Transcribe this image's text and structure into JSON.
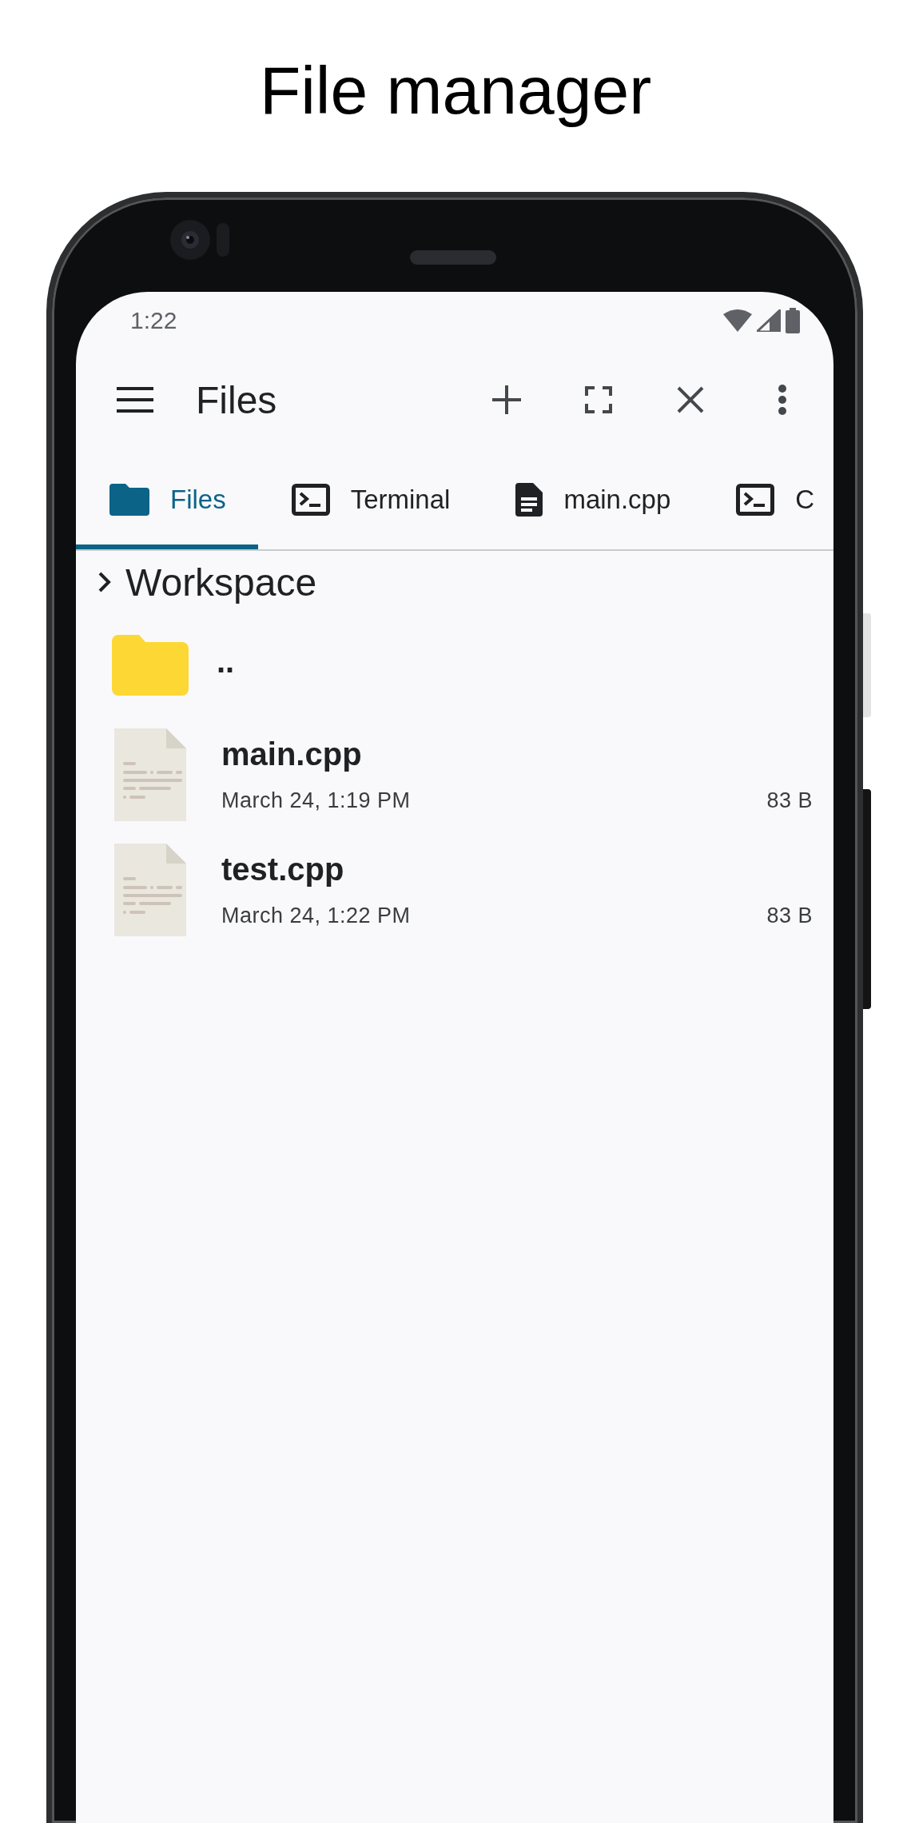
{
  "heading": "File manager",
  "status_bar": {
    "time": "1:22"
  },
  "app_bar": {
    "title": "Files"
  },
  "tabs": [
    {
      "label": "Files",
      "kind": "folder",
      "selected": true
    },
    {
      "label": "Terminal",
      "kind": "terminal",
      "selected": false
    },
    {
      "label": "main.cpp",
      "kind": "document",
      "selected": false
    },
    {
      "label": "C",
      "kind": "terminal",
      "selected": false
    }
  ],
  "breadcrumb": {
    "label": "Workspace"
  },
  "files": [
    {
      "kind": "folder",
      "name": ".."
    },
    {
      "kind": "file",
      "name": "main.cpp",
      "modified": "March 24, 1:19 PM",
      "size": "83 B"
    },
    {
      "kind": "file",
      "name": "test.cpp",
      "modified": "March 24, 1:22 PM",
      "size": "83 B"
    }
  ]
}
